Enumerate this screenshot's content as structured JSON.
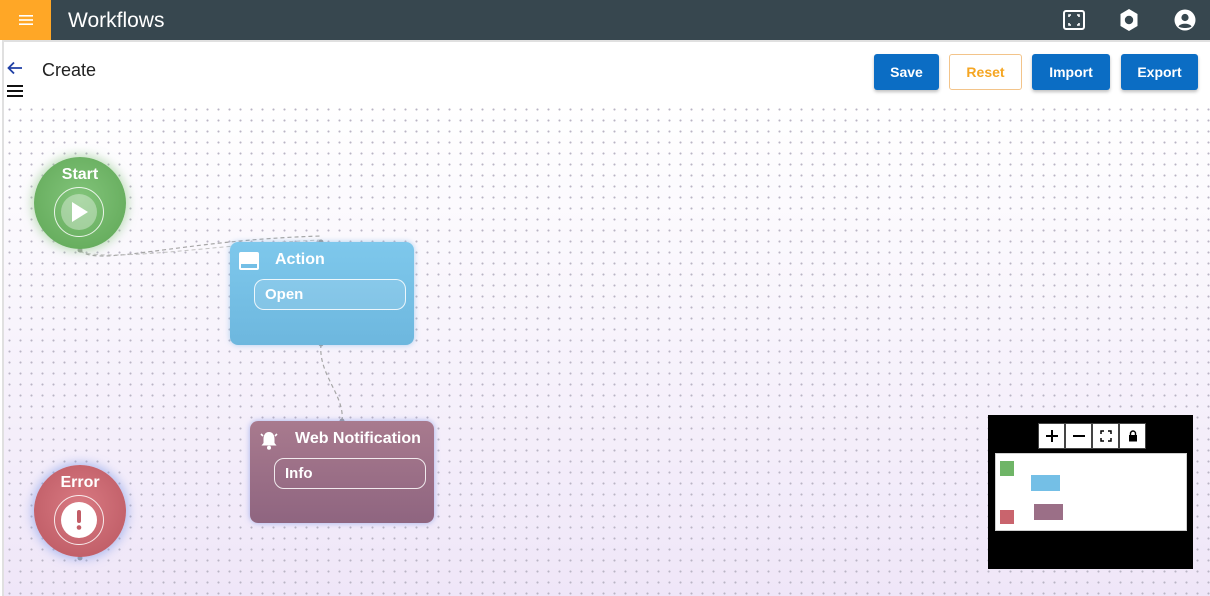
{
  "app": {
    "title": "Workflows"
  },
  "header": {
    "page_title": "Create",
    "buttons": {
      "save": "Save",
      "reset": "Reset",
      "import": "Import",
      "export": "Export"
    }
  },
  "colors": {
    "appbar": "#37474f",
    "menu_accent": "#ffa726",
    "primary_button": "#0b6dc4",
    "reset_text": "#f5a623",
    "start_node": "#6fb567",
    "error_node": "#c9646d",
    "action_node": "#74bfe6",
    "notification_node": "#9b6f87"
  },
  "nodes": {
    "start": {
      "label": "Start",
      "icon": "play-icon"
    },
    "error": {
      "label": "Error",
      "icon": "exclamation-icon"
    },
    "action": {
      "title": "Action",
      "icon": "window-icon",
      "value": "Open"
    },
    "notification": {
      "title": "Web Notification",
      "icon": "bell-icon",
      "value": "Info"
    }
  },
  "minimap": {
    "controls": [
      "zoom-in",
      "zoom-out",
      "fit-view",
      "lock"
    ]
  },
  "icons": {
    "menu": "hamburger-icon",
    "fullscreen": "fullscreen-icon",
    "settings": "gear-icon",
    "account": "account-icon",
    "back": "back-arrow-icon"
  }
}
